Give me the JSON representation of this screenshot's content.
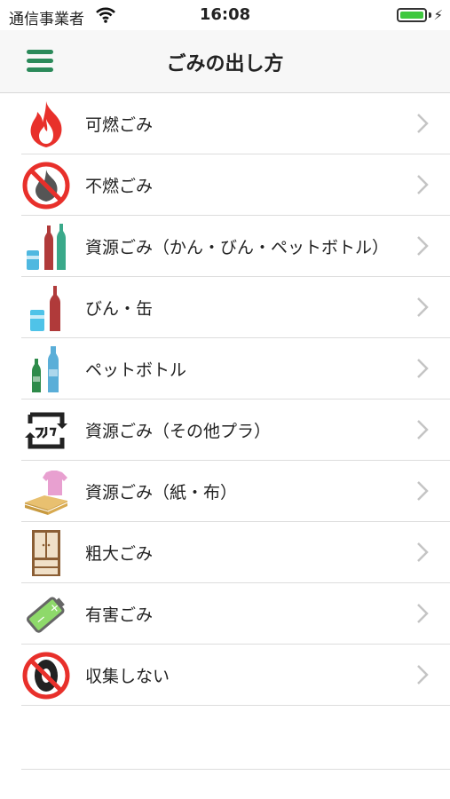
{
  "status": {
    "carrier": "通信事業者",
    "time": "16:08"
  },
  "header": {
    "title": "ごみの出し方",
    "menu_icon": "hamburger-menu-icon"
  },
  "items": [
    {
      "label": "可燃ごみ",
      "icon": "flame-icon"
    },
    {
      "label": "不燃ごみ",
      "icon": "no-burn-icon"
    },
    {
      "label": "資源ごみ（かん・びん・ペットボトル）",
      "icon": "bottles-cans-icon"
    },
    {
      "label": "びん・缶",
      "icon": "bottle-can-icon"
    },
    {
      "label": "ペットボトル",
      "icon": "pet-bottles-icon"
    },
    {
      "label": "資源ごみ（その他プラ）",
      "icon": "plastic-recycle-icon"
    },
    {
      "label": "資源ごみ（紙・布）",
      "icon": "paper-cloth-icon"
    },
    {
      "label": "粗大ごみ",
      "icon": "cabinet-icon"
    },
    {
      "label": "有害ごみ",
      "icon": "battery-icon"
    },
    {
      "label": "収集しない",
      "icon": "no-collection-tire-icon"
    }
  ],
  "colors": {
    "accent": "#2b8a5a",
    "red": "#e53a3a",
    "divider": "#dddddd"
  }
}
